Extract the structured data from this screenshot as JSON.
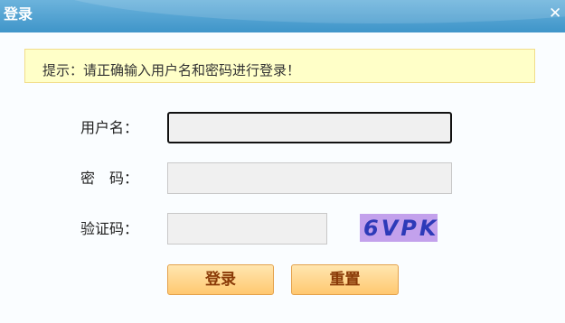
{
  "window": {
    "title": "登录",
    "close_icon": "close-icon"
  },
  "tip": {
    "text": "提示：请正确输入用户名和密码进行登录！"
  },
  "form": {
    "username_label": "用户名：",
    "username_value": "",
    "password_label": "密　码：",
    "password_value": "",
    "captcha_label": "验证码：",
    "captcha_value": "",
    "captcha_text": "6VPK"
  },
  "buttons": {
    "login_label": "登录",
    "reset_label": "重置"
  },
  "colors": {
    "titlebar": "#4a9fd2",
    "tip_background": "#ffffc8",
    "button_gradient_top": "#ffe6b0",
    "button_gradient_bottom": "#ffc870",
    "button_text": "#8a3a07",
    "captcha_background": "#c3a1ec",
    "captcha_text": "#2d3ab8"
  }
}
